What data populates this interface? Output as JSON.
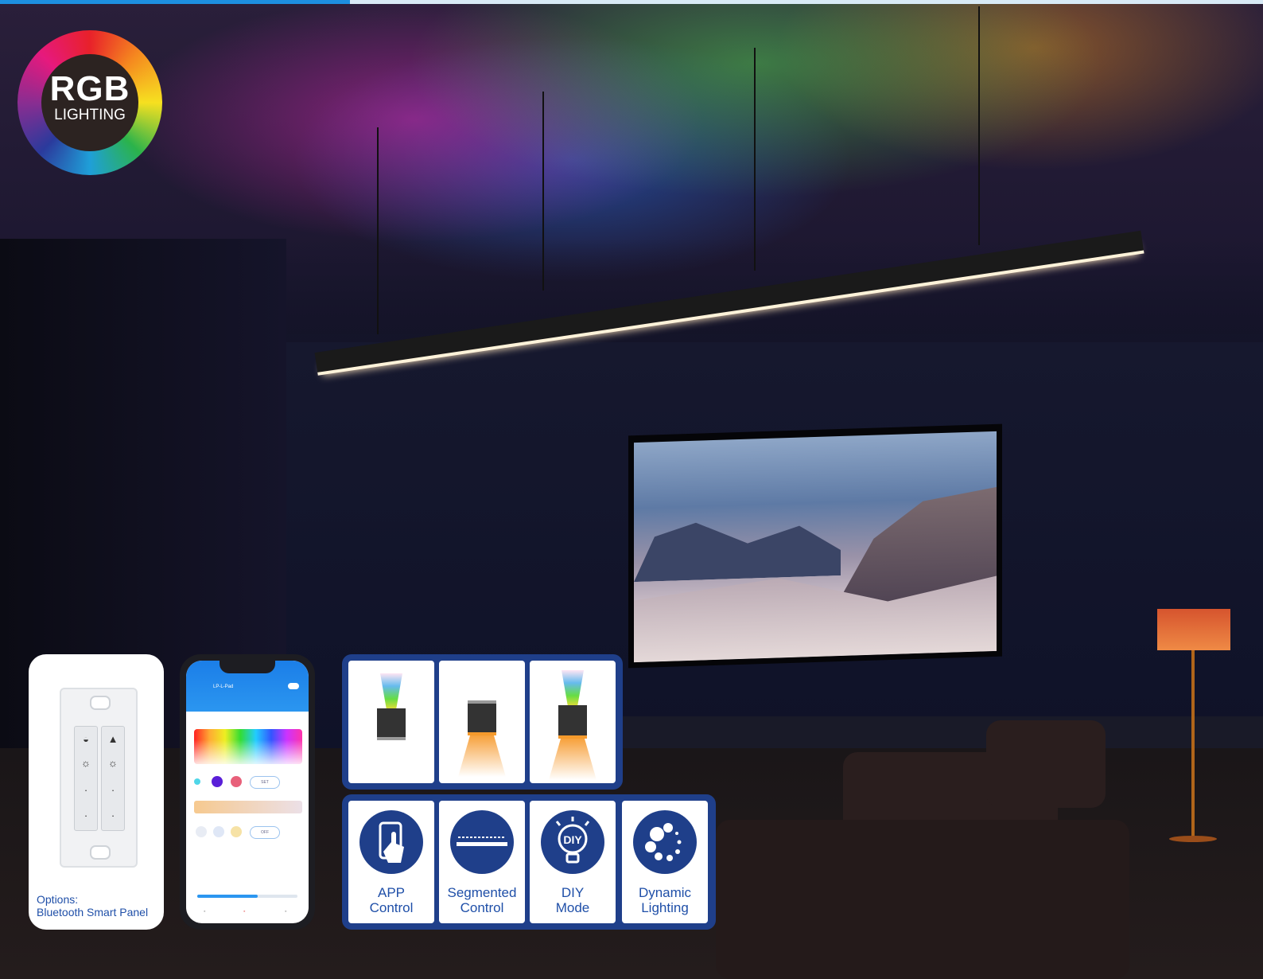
{
  "badge": {
    "title": "RGB",
    "subtitle": "LIGHTING"
  },
  "panel": {
    "caption_line1": "Options:",
    "caption_line2": "Bluetooth Smart Panel"
  },
  "phone_app": {
    "header_title": "LP-L-Pad",
    "pill_1": "SET",
    "pill_2": "OFF",
    "brightness_level": 0.6
  },
  "beam_modes": [
    {
      "name": "up-light"
    },
    {
      "name": "down-light"
    },
    {
      "name": "up-down-light"
    }
  ],
  "features": [
    {
      "line1": "APP",
      "line2": "Control",
      "icon": "phone-touch-icon"
    },
    {
      "line1": "Segmented",
      "line2": "Control",
      "icon": "segmented-strip-icon"
    },
    {
      "line1": "DIY",
      "line2": "Mode",
      "icon": "diy-bulb-icon"
    },
    {
      "line1": "Dynamic",
      "line2": "Lighting",
      "icon": "dynamic-dots-icon"
    }
  ],
  "colors": {
    "brand_blue": "#1f3f8a",
    "text_blue": "#1f4fa8",
    "accent_bar": "#1d8fe0"
  }
}
